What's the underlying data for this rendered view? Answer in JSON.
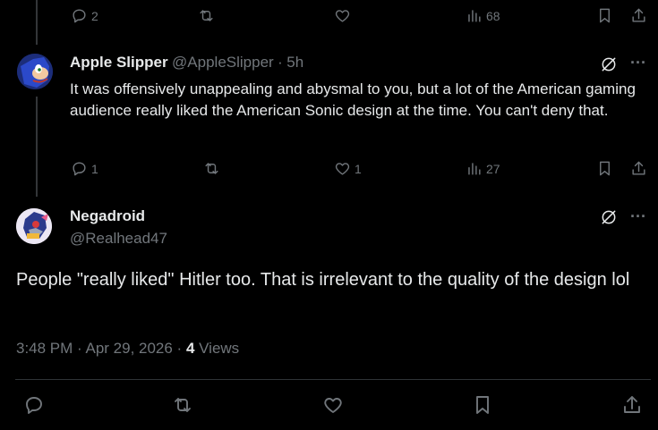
{
  "top_actions": {
    "replies": "2",
    "views": "68"
  },
  "reply": {
    "name": "Apple Slipper",
    "handle": "@AppleSlipper",
    "sep": "·",
    "time": "5h",
    "text": "It was offensively unappealing and abysmal to you, but a lot of the American gaming audience really liked the American Sonic design at the time. You can't deny that.",
    "replies": "1",
    "likes": "1",
    "views": "27"
  },
  "main": {
    "name": "Negadroid",
    "handle": "@Realhead47",
    "text": "People \"really liked\" Hitler too. That is irrelevant to the quality of the design lol",
    "timestamp": "3:48 PM · Apr 29, 2026 · ",
    "views_count": "4",
    "views_label": " Views"
  },
  "more_glyph": "···",
  "colors": {
    "background": "#000000",
    "text": "#e7e9ea",
    "muted": "#71767b",
    "divider": "#2f3336"
  }
}
